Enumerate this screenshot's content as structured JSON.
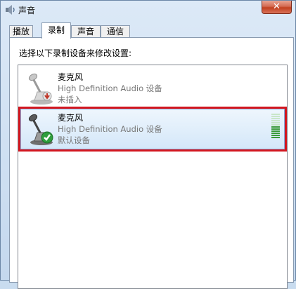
{
  "window": {
    "title": "声音",
    "close_label": "✕"
  },
  "tabs": [
    {
      "label": "播放",
      "active": false
    },
    {
      "label": "录制",
      "active": true
    },
    {
      "label": "声音",
      "active": false
    },
    {
      "label": "通信",
      "active": false
    }
  ],
  "panel": {
    "instruction": "选择以下录制设备来修改设置:"
  },
  "devices": [
    {
      "name": "麦克风",
      "description": "High Definition Audio 设备",
      "status": "未插入",
      "icon": "microphone-unplugged-icon",
      "selected": false
    },
    {
      "name": "麦克风",
      "description": "High Definition Audio 设备",
      "status": "默认设备",
      "icon": "microphone-default-icon",
      "selected": true,
      "level_fraction": 0.5
    }
  ],
  "colors": {
    "highlight": "#d3161f",
    "level_on": "#3a9a3a",
    "level_off": "#c8e6c8"
  }
}
